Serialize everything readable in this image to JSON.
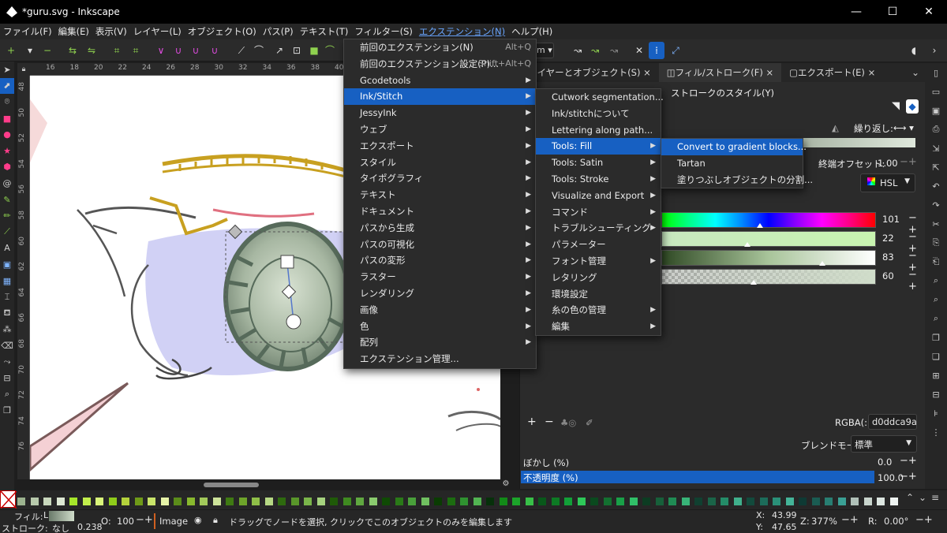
{
  "window": {
    "title": "*guru.svg - Inkscape"
  },
  "menubar": [
    "ファイル(F)",
    "編集(E)",
    "表示(V)",
    "レイヤー(L)",
    "オブジェクト(O)",
    "パス(P)",
    "テキスト(T)",
    "フィルター(S)",
    "エクステンション(N)",
    "ヘルプ(H)"
  ],
  "extensions_menu": {
    "items": [
      {
        "label": "前回のエクステンション(N)",
        "accel": "Alt+Q"
      },
      {
        "label": "前回のエクステンション設定(P)...",
        "accel": "Shift+Alt+Q"
      },
      {
        "label": "Gcodetools",
        "sub": true
      },
      {
        "label": "Ink/Stitch",
        "sub": true,
        "highlight": true
      },
      {
        "label": "JessyInk",
        "sub": true
      },
      {
        "label": "ウェブ",
        "sub": true
      },
      {
        "label": "エクスポート",
        "sub": true
      },
      {
        "label": "スタイル",
        "sub": true
      },
      {
        "label": "タイポグラフィ",
        "sub": true
      },
      {
        "label": "テキスト",
        "sub": true
      },
      {
        "label": "ドキュメント",
        "sub": true
      },
      {
        "label": "パスから生成",
        "sub": true
      },
      {
        "label": "パスの可視化",
        "sub": true
      },
      {
        "label": "パスの変形",
        "sub": true
      },
      {
        "label": "ラスター",
        "sub": true
      },
      {
        "label": "レンダリング",
        "sub": true
      },
      {
        "label": "画像",
        "sub": true
      },
      {
        "label": "色",
        "sub": true
      },
      {
        "label": "配列",
        "sub": true
      },
      {
        "label": "エクステンション管理..."
      }
    ]
  },
  "inkstitch_menu": {
    "items": [
      {
        "label": "Cutwork segmentation..."
      },
      {
        "label": "Ink/stitchについて"
      },
      {
        "label": "Lettering along path..."
      },
      {
        "label": "Tools: Fill",
        "sub": true,
        "highlight": true
      },
      {
        "label": "Tools: Satin",
        "sub": true
      },
      {
        "label": "Tools: Stroke",
        "sub": true
      },
      {
        "label": "Visualize and Export",
        "sub": true
      },
      {
        "label": "コマンド",
        "sub": true
      },
      {
        "label": "トラブルシューティング",
        "sub": true
      },
      {
        "label": "パラメーター"
      },
      {
        "label": "フォント管理",
        "sub": true
      },
      {
        "label": "レタリング"
      },
      {
        "label": "環境設定"
      },
      {
        "label": "糸の色の管理",
        "sub": true
      },
      {
        "label": "編集",
        "sub": true
      }
    ]
  },
  "fill_menu": {
    "items": [
      {
        "label": "Convert to gradient blocks...",
        "highlight": true
      },
      {
        "label": "Tartan"
      },
      {
        "label": "塗りつぶしオブジェクトの分割..."
      }
    ]
  },
  "ctrlbar": {
    "unit": "m"
  },
  "dock": {
    "tabs": [
      {
        "label": "レイヤーとオブジェクト(S)",
        "close": "×"
      },
      {
        "label": "フィル/ストローク(F)",
        "close": "×"
      },
      {
        "label": "エクスポート(E)",
        "close": "×"
      }
    ],
    "stroke_style_label": "ストロークのスタイル(Y)",
    "repeat_label": "繰り返し:",
    "end_offset_label": "終端オフセット:",
    "end_offset_value": "1.00",
    "color_mode": "HSL",
    "sliders": [
      {
        "name": "hue",
        "value": "101",
        "marker": 0.46
      },
      {
        "name": "saturation",
        "value": "22",
        "marker": 0.4
      },
      {
        "name": "lightness",
        "value": "83",
        "marker": 0.75
      },
      {
        "name": "alpha",
        "value": "60",
        "marker": 0.43
      }
    ],
    "rgba_label": "RGBA(:)",
    "rgba_value": "d0ddca9a",
    "blend_label": "ブレンドモード:",
    "blend_value": "標準",
    "blur_label": "ぼかし (%)",
    "blur_value": "0.0",
    "opacity_label": "不透明度 (%)",
    "opacity_value": "100.0"
  },
  "statusbar": {
    "fill_label": "フィル:",
    "fill_value": "L",
    "stroke_label": "ストローク:",
    "stroke_value": "なし",
    "stroke_width": "0.238",
    "opacity_label": "O:",
    "opacity_value": "100",
    "layer": "Image",
    "message": "ドラッグでノードを選択, クリックでこのオブジェクトのみを編集します",
    "x_label": "X:",
    "x_value": "43.99",
    "y_label": "Y:",
    "y_value": "47.65",
    "zoom_label": "Z:",
    "zoom_value": "377%",
    "rot_label": "R:",
    "rot_value": "0.00°"
  },
  "ruler_top_labels": [
    "16",
    "18",
    "20",
    "22",
    "24",
    "26",
    "28",
    "30",
    "32",
    "34",
    "36",
    "38",
    "40"
  ],
  "ruler_left_labels": [
    "48",
    "50",
    "52",
    "54",
    "56",
    "58",
    "60",
    "62",
    "64",
    "66",
    "68",
    "70",
    "72",
    "74",
    "76"
  ],
  "colors": {
    "highlight": "#1760c2",
    "selection_fill": "#d0ddca",
    "eye_iris": "#566a5a",
    "lash_yellow": "#c8a020"
  }
}
